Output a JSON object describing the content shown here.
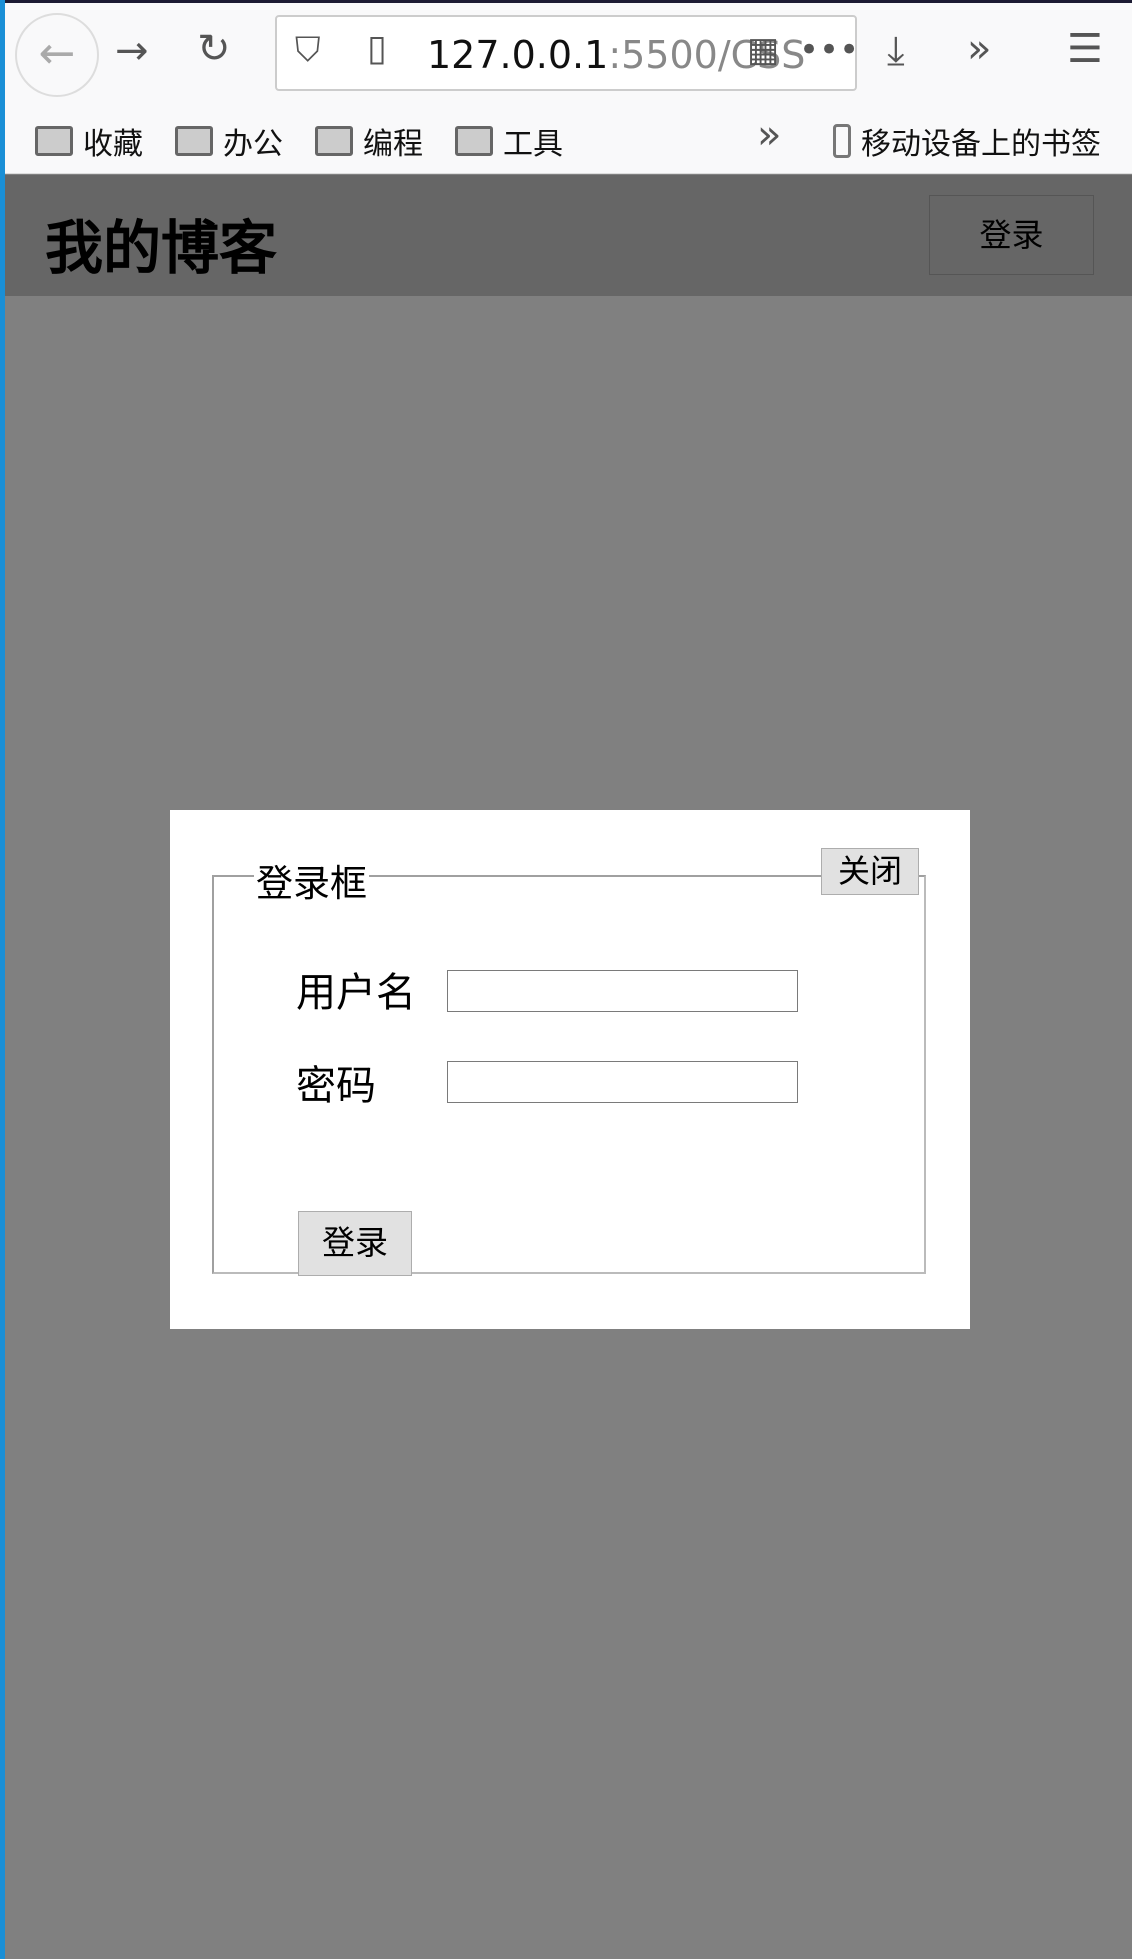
{
  "browser": {
    "url_host": "127.0.0.1",
    "url_rest": ":5500/CSS",
    "bookmarks": [
      "收藏",
      "办公",
      "编程",
      "工具"
    ],
    "mobile_bookmarks": "移动设备上的书签"
  },
  "header": {
    "title": "我的博客",
    "login_label": "登录"
  },
  "modal": {
    "legend": "登录框",
    "close_label": "关闭",
    "username_label": "用户名",
    "username_value": "",
    "password_label": "密码",
    "password_value": "",
    "submit_label": "登录"
  }
}
